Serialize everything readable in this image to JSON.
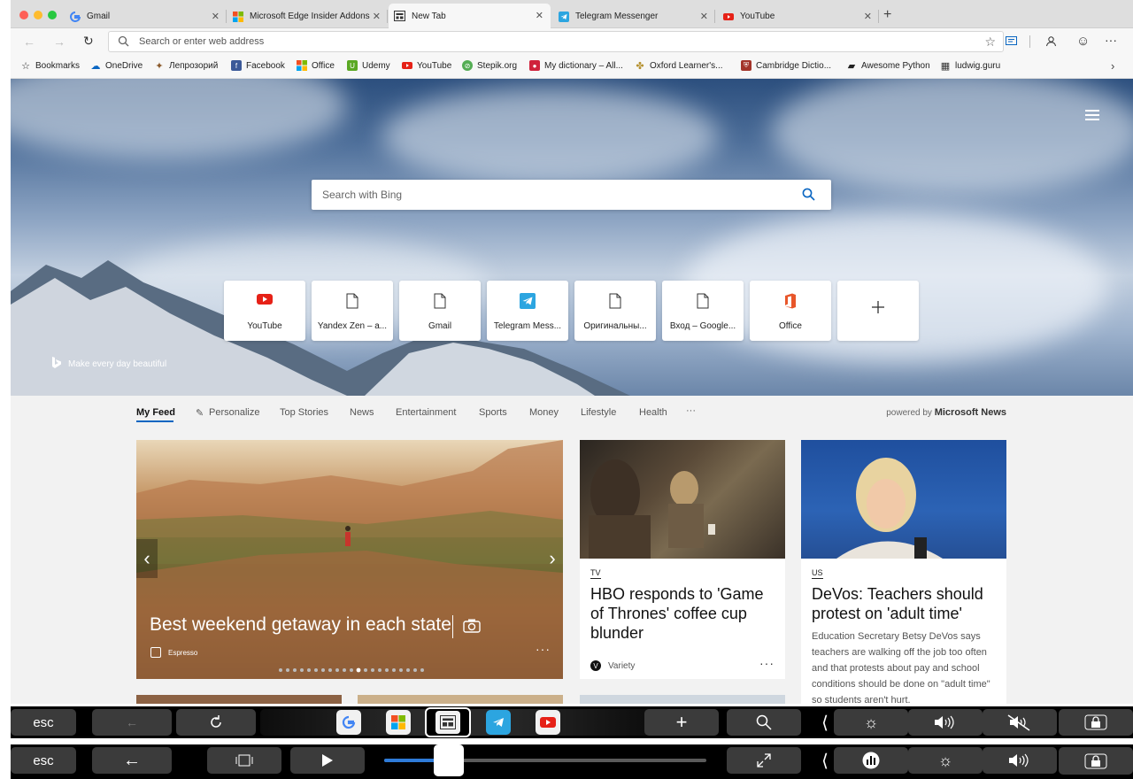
{
  "tabs": [
    {
      "title": "Gmail",
      "icon": "google-icon"
    },
    {
      "title": "Microsoft Edge Insider Addons",
      "icon": "microsoft-icon"
    },
    {
      "title": "New Tab",
      "icon": "newtab-icon"
    },
    {
      "title": "Telegram Messenger",
      "icon": "telegram-icon"
    },
    {
      "title": "YouTube",
      "icon": "youtube-icon"
    }
  ],
  "new_tab_glyph": "+",
  "address_bar": {
    "placeholder": "Search or enter web address"
  },
  "bookmarks": [
    {
      "label": "Bookmarks",
      "color": "#222222"
    },
    {
      "label": "OneDrive",
      "color": "#0a66c2"
    },
    {
      "label": "Лепрозорий",
      "color": "#8b5a2b"
    },
    {
      "label": "Facebook",
      "color": "#3b5998"
    },
    {
      "label": "Office",
      "color": "#e8562a"
    },
    {
      "label": "Udemy",
      "color": "#5aa823"
    },
    {
      "label": "YouTube",
      "color": "#e62117"
    },
    {
      "label": "Stepik.org",
      "color": "#54ad54"
    },
    {
      "label": "My dictionary – All...",
      "color": "#d0223b"
    },
    {
      "label": "Oxford Learner's...",
      "color": "#b5912f"
    },
    {
      "label": "Cambridge Dictio...",
      "color": "#a3342a"
    },
    {
      "label": "Awesome Python",
      "color": "#222222"
    },
    {
      "label": "ludwig.guru",
      "color": "#333333"
    }
  ],
  "hero": {
    "search_placeholder": "Search with Bing",
    "tagline": "Make every day beautiful"
  },
  "top_sites": [
    {
      "label": "YouTube",
      "icon": "youtube-icon"
    },
    {
      "label": "Yandex Zen – a...",
      "icon": "page-icon"
    },
    {
      "label": "Gmail",
      "icon": "page-icon"
    },
    {
      "label": "Telegram Mess...",
      "icon": "telegram-icon"
    },
    {
      "label": "Оригинальны...",
      "icon": "page-icon"
    },
    {
      "label": "Вход – Google...",
      "icon": "page-icon"
    },
    {
      "label": "Office",
      "icon": "office-icon"
    },
    {
      "label": "",
      "icon": "plus-icon"
    }
  ],
  "feed_nav": [
    "My Feed",
    "Personalize",
    "Top Stories",
    "News",
    "Entertainment",
    "Sports",
    "Money",
    "Lifestyle",
    "Health",
    "···"
  ],
  "powered_by": {
    "prefix": "powered by",
    "brand": "Microsoft News"
  },
  "cards": {
    "main": {
      "headline": "Best weekend getaway in each state",
      "source": "Espresso"
    },
    "hbo": {
      "category": "TV",
      "headline": "HBO responds to 'Game of Thrones' coffee cup blunder",
      "source": "Variety"
    },
    "devos": {
      "category": "US",
      "headline": "DeVos: Teachers should protest on 'adult time'",
      "summary": "Education Secretary Betsy DeVos says teachers are walking off the job too often and that protests about pay and school conditions should be done on \"adult time\" so students aren't hurt."
    }
  },
  "touchbar_top": {
    "esc": "esc"
  },
  "touchbar_bottom": {
    "esc": "esc",
    "progress": 0.2
  }
}
